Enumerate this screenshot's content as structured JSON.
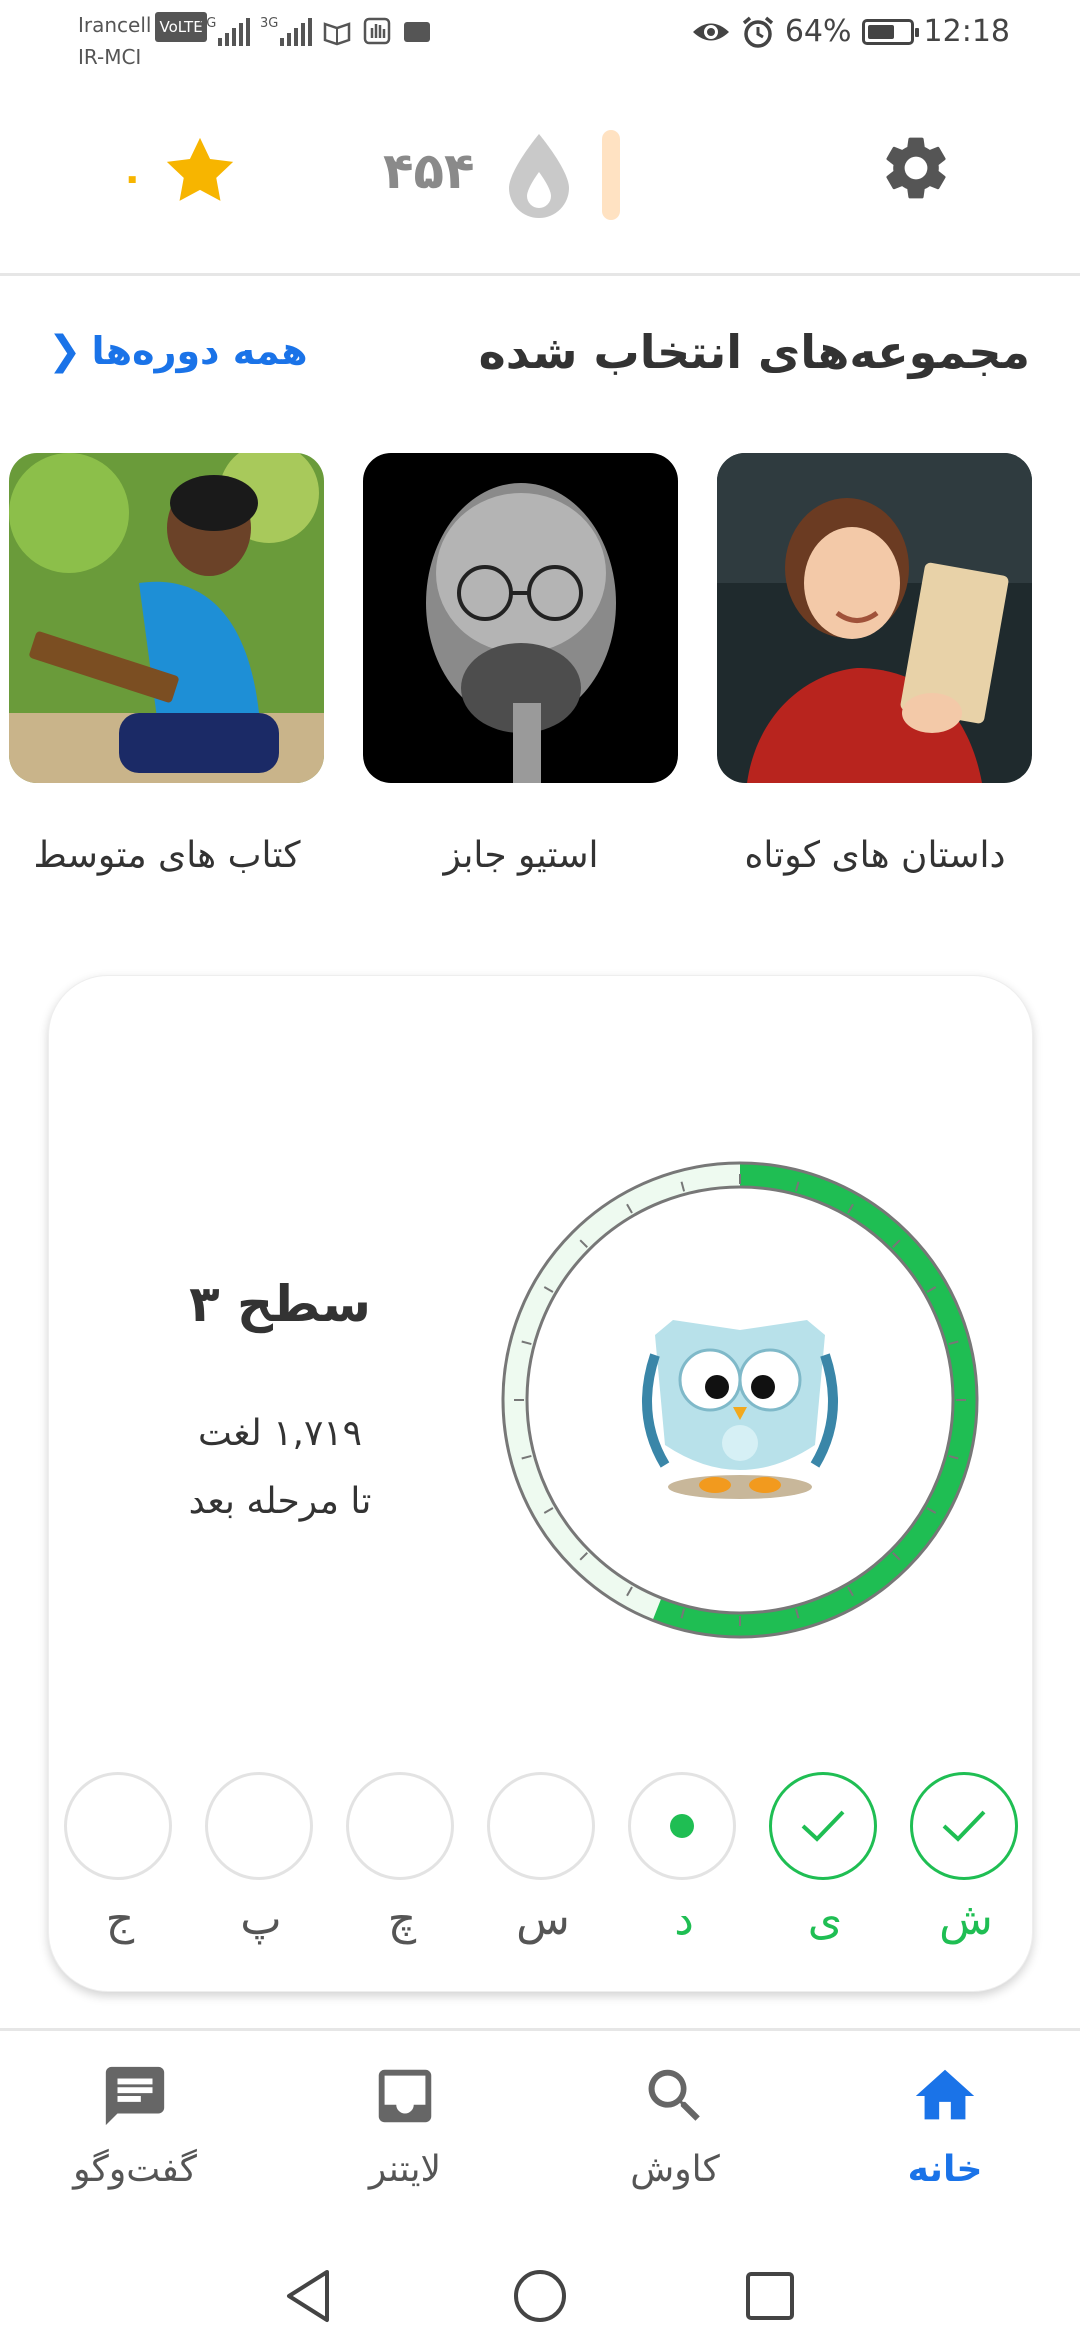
{
  "status_bar": {
    "carrier_top": "Irancell",
    "volte_badge": "VoLTE",
    "carrier_bottom": "IR-MCI",
    "network_1": "4G",
    "network_2": "3G",
    "battery_percent": "64%",
    "time": "12:18"
  },
  "header": {
    "streak_count": "۴۵۴",
    "stars_count": "۰"
  },
  "collections": {
    "title": "مجموعه‌های انتخاب شده",
    "all_courses": "همه دوره‌ها",
    "items": [
      {
        "label": "داستان های کوتاه"
      },
      {
        "label": "استیو جابز"
      },
      {
        "label": "کتاب های متوسط"
      }
    ]
  },
  "level_card": {
    "title": "سطح ۳",
    "words": "۱,۷۱۹ لغت",
    "until_next": "تا مرحله بعد",
    "progress": 0.56
  },
  "steps": [
    {
      "letter": "ش",
      "state": "done"
    },
    {
      "letter": "ی",
      "state": "done"
    },
    {
      "letter": "د",
      "state": "current"
    },
    {
      "letter": "س",
      "state": "todo"
    },
    {
      "letter": "چ",
      "state": "todo"
    },
    {
      "letter": "پ",
      "state": "todo"
    },
    {
      "letter": "ج",
      "state": "todo"
    }
  ],
  "bottom_nav": {
    "home": "خانه",
    "search": "کاوش",
    "leitner": "لایتنر",
    "chat": "گفت‌وگو"
  },
  "colors": {
    "accent": "#1a73e8",
    "green": "#1fbe53",
    "star": "#f7b500"
  }
}
